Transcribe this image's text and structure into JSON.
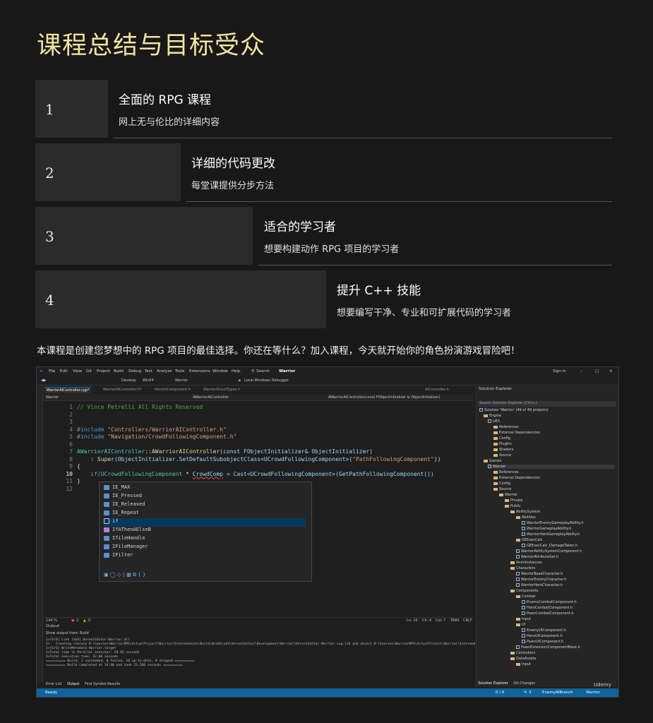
{
  "page": {
    "title": "课程总结与目标受众",
    "items": [
      {
        "num": "1",
        "title": "全面的 RPG 课程",
        "subtitle": "网上无与伦比的详细内容"
      },
      {
        "num": "2",
        "title": "详细的代码更改",
        "subtitle": "每堂课提供分步方法"
      },
      {
        "num": "3",
        "title": "适合的学习者",
        "subtitle": "想要构建动作 RPG 项目的学习者"
      },
      {
        "num": "4",
        "title": "提升 C++ 技能",
        "subtitle": "想要编写干净、专业和可扩展代码的学习者"
      }
    ],
    "summary": "本课程是创建您梦想中的 RPG 项目的最佳选择。你还在等什么？加入课程，今天就开始你的角色扮演游戏冒险吧！"
  },
  "ide": {
    "menu": [
      "File",
      "Edit",
      "View",
      "Git",
      "Project",
      "Build",
      "Debug",
      "Test",
      "Analyze",
      "Tools",
      "Extensions",
      "Window",
      "Help"
    ],
    "search_label": "Search",
    "solution_name": "Warrior",
    "sign_in": "Sign in",
    "toolbar": {
      "config": "Develop",
      "platform": "Win64",
      "project": "Warrior",
      "debugger": "Local Windows Debugger"
    },
    "tabs": [
      "WarriorAIController.cpp*",
      "WarriorAIController.h*",
      "HeroUIComponent.h",
      "WarriorStructTypes.h",
      "AIController.h"
    ],
    "nav": {
      "project": "Warrior",
      "class": "AWarriorAIController",
      "member": "AWarriorAIController(const FObjectInitializer & ObjectInitializer)"
    },
    "line_numbers": [
      "1",
      "2",
      "3",
      "4",
      "5",
      "6",
      "7",
      "8",
      "9",
      "10",
      "11",
      "12"
    ],
    "code": {
      "l1": "// Vince Petrelli All Rights Reserved",
      "l4_kw": "#include",
      "l4_str": "\"Controllers/WarriorAIController.h\"",
      "l5_kw": "#include",
      "l5_str": "\"Navigation/CrowdFollowingComponent.h\"",
      "l7_type": "AWarriorAIController",
      "l7_sep": "::",
      "l7_fn": "AWarriorAIController",
      "l7_rest": "(const FObjectInitializer& ObjectInitializer)",
      "l8_pre": "    : ",
      "l8_fn": "Super",
      "l8_rest": "(ObjectInitializer.SetDefaultSubobjectClass<UCrowdFollowingComponent>(",
      "l8_str": "\"PathFollowingComponent\"",
      "l8_end": "))",
      "l9": "{",
      "l10_pre": "    if(",
      "l10_type": "UCrowdFollowingComponent",
      "l10_mid": " * ",
      "l10_var": "CrowdComp",
      "l10_rest": " = Cast<UCrowdFollowingComponent>(GetPathFollowingComponent())",
      "l11": "}"
    },
    "autocomplete": [
      "IE_MAX",
      "IE_Pressed",
      "IE_Released",
      "IE_Repeat",
      "if",
      "IfAThenAElseB",
      "IfileHandle",
      "IFileManager",
      "IFilter"
    ],
    "status_line": {
      "zoom": "144 %",
      "errors": "2",
      "warnings": "0",
      "ln": "Ln: 10",
      "ch": "Ch: 4",
      "col": "Col: 7",
      "tabs": "TABS",
      "crlf": "CRLF"
    },
    "output": {
      "header": "Output",
      "show_from": "Show output from:",
      "source": "Build",
      "lines": [
        "1>[6/6] Link [x64] UnrealEditor-Warrior.dll",
        "1>   Creating library D:\\Courses\\WarriorRPG\\ActualProject\\Warrior\\Intermediate\\Build\\Win64\\x64\\UnrealEditor\\Development\\Warrior\\UnrealEditor-Warrior.sup.lib and object D:\\Courses\\WarriorRPG\\ActualProject\\Warrior\\Intermediate\\Build",
        "1>[6/6] WriteMetadata Warrior.target",
        "1>Total time in Parallel executor: 20.45 seconds",
        "1>Total execution time: 22.06 seconds",
        "========== Build: 1 succeeded, 0 failed, 10 up-to-date, 0 skipped ==========",
        "========== Build completed at 14:40 and took 23.160 seconds =========="
      ],
      "tabs": [
        "Error List",
        "Output",
        "Find Symbol Results"
      ]
    },
    "solution_explorer": {
      "title": "Solution Explorer",
      "search": "Search Solution Explorer (Ctrl+;)",
      "tree": [
        "Solution 'Warrior' (49 of 49 projects)",
        "Engine",
        "UE5",
        "References",
        "External Dependencies",
        "Config",
        "Plugins",
        "Shaders",
        "Source",
        "Games",
        "Warrior",
        "References",
        "External Dependencies",
        "Config",
        "Source",
        "Warrior",
        "Private",
        "Public",
        "AbilitySystem",
        "Abilities",
        "WarriorEnemyGameplayAbility.h",
        "WarriorGameplayAbility.h",
        "WarriorHeroGameplayAbility.h",
        "GEExecCalc",
        "GEExecCalc_DamageTaken.h",
        "WarriorAbilitySystemComponent.h",
        "WarriorAttributeSet.h",
        "AnimInstances",
        "Characters",
        "WarriorBaseCharacter.h",
        "WarriorEnemyCharacter.h",
        "WarriorHeroCharacter.h",
        "Components",
        "Combat",
        "EnemyCombatComponent.h",
        "HeroCombatComponent.h",
        "PawnCombatComponent.h",
        "Input",
        "UI",
        "EnemyUIComponent.h",
        "HeroUIComponent.h",
        "PawnUIComponent.h",
        "PawnExtensionComponentBase.h",
        "Controllers",
        "DataAssets",
        "Input"
      ],
      "tabs": [
        "Solution Explorer",
        "Git Changes"
      ]
    },
    "statusbar": {
      "ready": "Ready",
      "position": "0 / 0",
      "changes": "3",
      "branch": "EnemyAIBranch",
      "repo": "Warrior"
    },
    "watermark": "Udemy"
  },
  "colors": {
    "title": "#f2e4a0",
    "card": "#2b2b2b",
    "background": "#181818",
    "status_bar": "#0e639c"
  }
}
